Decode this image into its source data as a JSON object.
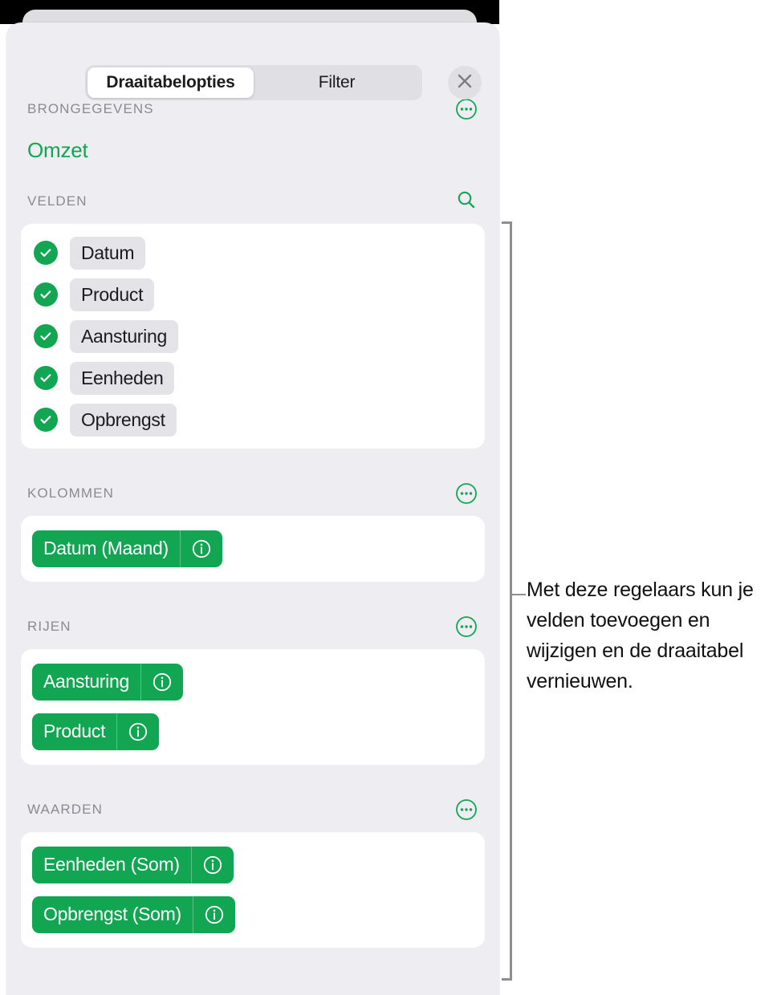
{
  "window": {
    "panel_bg": "#eeeef2",
    "accent_green": "#12a652"
  },
  "header": {
    "tabs": [
      {
        "label": "Draaitabelopties",
        "selected": true
      },
      {
        "label": "Filter",
        "selected": false
      }
    ],
    "close_label": "×",
    "close_icon": "close-icon"
  },
  "source": {
    "section_title": "BRONGEGEVENS",
    "name": "Omzet",
    "more_icon": "more-options-icon"
  },
  "fields": {
    "section_title": "VELDEN",
    "search_icon": "search-icon",
    "items": [
      {
        "label": "Datum",
        "checked": true
      },
      {
        "label": "Product",
        "checked": true
      },
      {
        "label": "Aansturing",
        "checked": true
      },
      {
        "label": "Eenheden",
        "checked": true
      },
      {
        "label": "Opbrengst",
        "checked": true
      }
    ]
  },
  "columns": {
    "section_title": "KOLOMMEN",
    "more_icon": "more-options-icon",
    "tokens": [
      {
        "label": "Datum (Maand)",
        "info_icon": "info-icon"
      }
    ]
  },
  "rows": {
    "section_title": "RIJEN",
    "more_icon": "more-options-icon",
    "tokens": [
      {
        "label": "Aansturing",
        "info_icon": "info-icon"
      },
      {
        "label": "Product",
        "info_icon": "info-icon"
      }
    ]
  },
  "values": {
    "section_title": "WAARDEN",
    "more_icon": "more-options-icon",
    "tokens": [
      {
        "label": "Eenheden (Som)",
        "info_icon": "info-icon"
      },
      {
        "label": "Opbrengst (Som)",
        "info_icon": "info-icon"
      }
    ]
  },
  "annotation": {
    "text": "Met deze regelaars kun je velden toevoegen en wijzigen en de draaitabel vernieuwen."
  }
}
